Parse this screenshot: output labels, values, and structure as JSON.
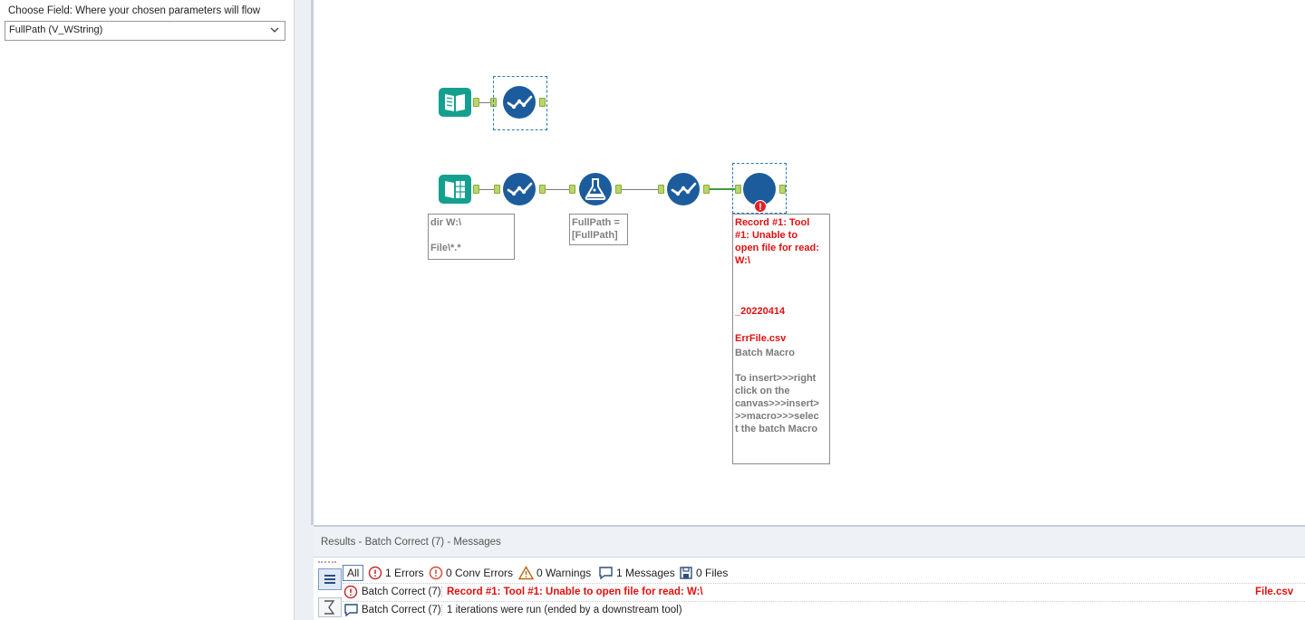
{
  "config": {
    "field_label": "Choose Field: Where your chosen parameters will flow",
    "field_value": "FullPath (V_WString)"
  },
  "canvas": {
    "tools": [
      {
        "name": "directory-tool-top",
        "icon": "directory-book-icon",
        "color": "#14a08f"
      },
      {
        "name": "batch-macro-tool-top",
        "icon": "batch-check-icon",
        "color": "#1d5c9c"
      },
      {
        "name": "directory-tool",
        "icon": "directory-grid-icon",
        "color": "#14a08f"
      },
      {
        "name": "control-parameter-tool",
        "icon": "batch-check-icon",
        "color": "#1d5c9c"
      },
      {
        "name": "formula-tool",
        "icon": "flask-icon",
        "color": "#1d5c9c"
      },
      {
        "name": "batch-check-tool",
        "icon": "batch-check-icon",
        "color": "#1d5c9c"
      },
      {
        "name": "batch-correct-tool",
        "icon": "blank-macro-icon",
        "color": "#1d5c9c"
      }
    ],
    "annotations": {
      "directory": [
        "dir W:\\",
        "File\\*.*"
      ],
      "formula": [
        "FullPath =",
        "[FullPath]"
      ],
      "batch_correct": {
        "error_lines": [
          "Record #1: Tool",
          "#1: Unable to",
          "open file for read:",
          "W:\\",
          "_20220414",
          "ErrFile.csv"
        ],
        "label": "Batch Macro",
        "instructions": [
          "To insert>>>right",
          "click on the",
          "canvas>>>insert>",
          ">>macro>>>selec",
          "t the batch Macro"
        ]
      }
    },
    "error_badge": "!"
  },
  "results": {
    "title": "Results - Batch Correct (7) - Messages",
    "filters": {
      "all": "All",
      "errors": "1 Errors",
      "conv_errors": "0 Conv Errors",
      "warnings": "0 Warnings",
      "messages": "1 Messages",
      "files": "0 Files"
    },
    "rows": [
      {
        "type": "error",
        "tool": "Batch Correct (7)",
        "text": "Record #1: Tool #1: Unable to open file for read: W:\\",
        "tail": "File.csv"
      },
      {
        "type": "message",
        "tool": "Batch Correct (7)",
        "text": "1 iterations were run (ended by a downstream tool)"
      }
    ]
  },
  "colors": {
    "teal_tool": "#14a08f",
    "blue_tool": "#1d5c9c",
    "error_red": "#e01010",
    "anchor_green": "#b9d66b"
  }
}
